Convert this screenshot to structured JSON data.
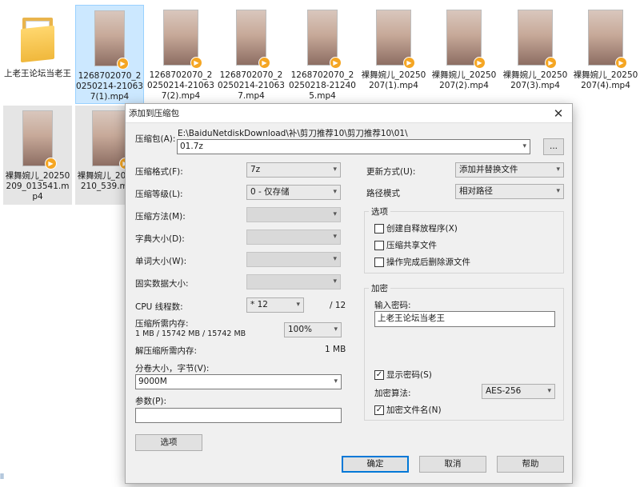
{
  "explorer": {
    "files": [
      {
        "name": "上老王论坛当老王",
        "type": "folder"
      },
      {
        "name": "1268702070_20250214-210637(1).mp4",
        "type": "video",
        "selected": true
      },
      {
        "name": "1268702070_20250214-210637(2).mp4",
        "type": "video"
      },
      {
        "name": "1268702070_20250214-210637.mp4",
        "type": "video"
      },
      {
        "name": "1268702070_20250218-212405.mp4",
        "type": "video"
      },
      {
        "name": "裸舞婉儿_20250207(1).mp4",
        "type": "video"
      },
      {
        "name": "裸舞婉儿_20250207(2).mp4",
        "type": "video"
      },
      {
        "name": "裸舞婉儿_20250207(3).mp4",
        "type": "video"
      },
      {
        "name": "裸舞婉儿_20250207(4).mp4",
        "type": "video"
      },
      {
        "name": "裸舞婉儿_20250209_013541.mp4",
        "type": "video"
      },
      {
        "name": "裸舞婉儿_20250210_539.mp4",
        "type": "video"
      }
    ],
    "edge_text": "ll"
  },
  "dialog": {
    "title": "添加到压缩包",
    "close_glyph": "✕",
    "archive_label": "压缩包(A):",
    "archive_path": "E:\\BaiduNetdiskDownload\\补\\剪刀推荐10\\剪刀推荐10\\01\\",
    "archive_name": "01.7z",
    "browse_label": "...",
    "left": {
      "format_label": "压缩格式(F):",
      "format_value": "7z",
      "level_label": "压缩等级(L):",
      "level_value": "0 - 仅存储",
      "method_label": "压缩方法(M):",
      "dict_label": "字典大小(D):",
      "word_label": "单词大小(W):",
      "solid_label": "固实数据大小:",
      "cpu_label": "CPU 线程数:",
      "cpu_value": "* 12",
      "cpu_max": "/ 12",
      "mem_label": "压缩所需内存:",
      "mem_detail": "1 MB / 15742 MB / 15742 MB",
      "mem_value": "100%",
      "decomp_label": "解压缩所需内存:",
      "decomp_value": "1 MB",
      "volume_label": "分卷大小，字节(V):",
      "volume_value": "9000M",
      "params_label": "参数(P):",
      "params_value": "",
      "options_button": "选项"
    },
    "right": {
      "update_label": "更新方式(U):",
      "update_value": "添加并替换文件",
      "path_label": "路径模式",
      "path_value": "相对路径",
      "options_group": "选项",
      "sfx_label": "创建自释放程序(X)",
      "sfx_checked": false,
      "shared_label": "压缩共享文件",
      "shared_checked": false,
      "delete_label": "操作完成后删除源文件",
      "delete_checked": false,
      "encrypt_group": "加密",
      "password_label": "输入密码:",
      "password_value": "上老王论坛当老王",
      "show_pw_label": "显示密码(S)",
      "show_pw_checked": true,
      "algo_label": "加密算法:",
      "algo_value": "AES-256",
      "encrypt_names_label": "加密文件名(N)",
      "encrypt_names_checked": true
    },
    "buttons": {
      "ok": "确定",
      "cancel": "取消",
      "help": "帮助"
    },
    "check_glyph": "✓",
    "arrow_glyph": "▾"
  }
}
